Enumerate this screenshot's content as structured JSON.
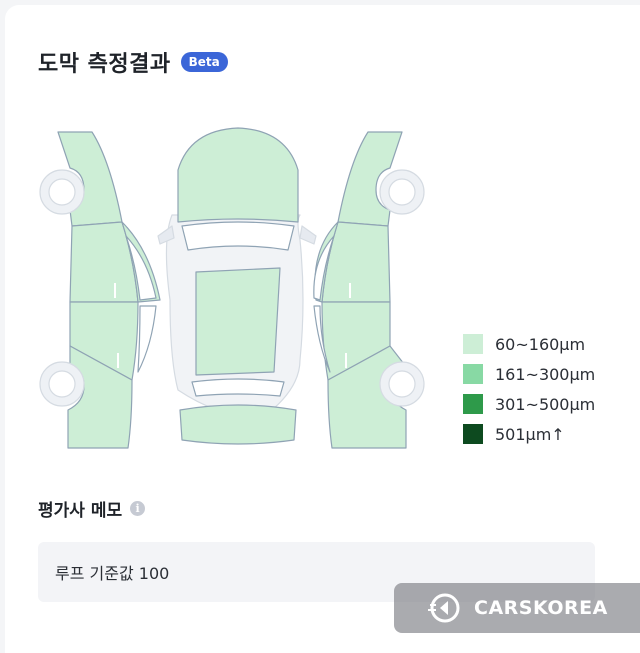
{
  "header": {
    "title": "도막 측정결과",
    "badge": "Beta"
  },
  "colors": {
    "panel_light": "#cdeed6",
    "panel_green": "#88d9a4",
    "panel_mid": "#2e9a4a",
    "panel_dark": "#0d4a1f",
    "panel_fill": "#cdeed6",
    "outline": "#8fa3b4",
    "beta_badge": "#3b66d8"
  },
  "legend": [
    {
      "label": "60~160μm",
      "color": "#cdeed6"
    },
    {
      "label": "161~300μm",
      "color": "#88d9a4"
    },
    {
      "label": "301~500μm",
      "color": "#2e9a4a"
    },
    {
      "label": "501μm↑",
      "color": "#0d4a1f"
    }
  ],
  "memo": {
    "title": "평가사 메모",
    "info_icon": "info-icon",
    "text": "루프 기준값 100"
  },
  "watermark": {
    "text": "CARSKOREA",
    "icon": "carskorea-logo-icon"
  }
}
